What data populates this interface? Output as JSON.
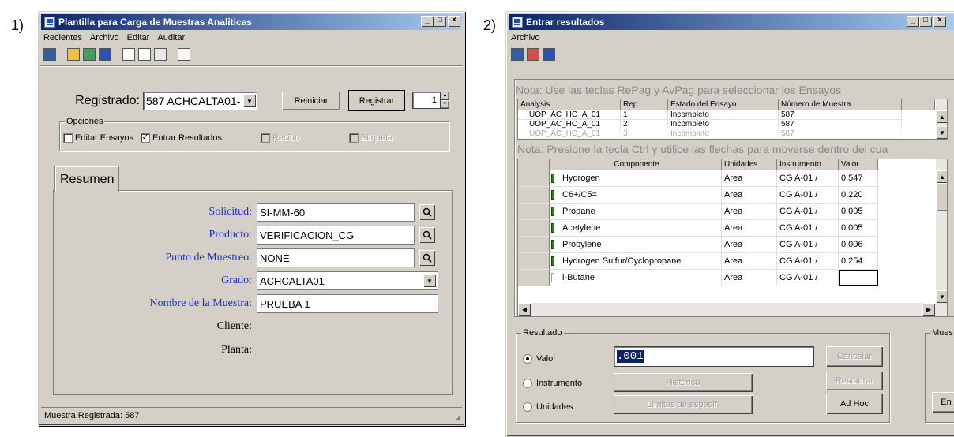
{
  "labels": {
    "one": "1)",
    "two": "2)"
  },
  "window1": {
    "title": "Plantilla para Carga de Muestras Analiticas",
    "menu": [
      "Recientes",
      "Archivo",
      "Editar",
      "Auditar"
    ],
    "registrado_label": "Registrado:",
    "registrado_value": "587   ACHCALTA01-",
    "reiniciar": "Reiniciar",
    "registrar": "Registrar",
    "spin_value": "1",
    "opciones_title": "Opciones",
    "opciones": [
      {
        "label": "Editar Ensayos",
        "checked": false,
        "enabled": true
      },
      {
        "label": "Entrar Resultados",
        "checked": true,
        "enabled": true
      },
      {
        "label": "Recibo",
        "checked": false,
        "enabled": false
      },
      {
        "label": "Etiqueta",
        "checked": false,
        "enabled": false
      }
    ],
    "tab": "Resumen",
    "fields": {
      "solicitud": {
        "label": "Solicitud:",
        "value": "SI-MM-60"
      },
      "producto": {
        "label": "Producto:",
        "value": "VERIFICACION_CG"
      },
      "punto": {
        "label": "Punto de Muestreo:",
        "value": "NONE"
      },
      "grado": {
        "label": "Grado:",
        "value": "ACHCALTA01"
      },
      "nombre": {
        "label": "Nombre de la Muestra:",
        "value": "PRUEBA 1"
      },
      "cliente": {
        "label": "Cliente:"
      },
      "planta": {
        "label": "Planta:"
      }
    },
    "status": "Muestra Registrada: 587"
  },
  "window2": {
    "title": "Entrar resultados",
    "menu": [
      "Archivo"
    ],
    "note1": "Nota:  Use las teclas RePag y AvPag para seleccionar los Ensayos",
    "grid1": {
      "headers": [
        "Analysis",
        "Rep",
        "Estado del Ensayo",
        "Número de Muestra"
      ],
      "rows": [
        [
          "UOP_AC_HC_A_01",
          "1",
          "Incompleto",
          "587"
        ],
        [
          "UOP_AC_HC_A_01",
          "2",
          "Incompleto",
          "587"
        ],
        [
          "UOP_AC_HC_A_01",
          "3",
          "Incompleto",
          "587"
        ]
      ]
    },
    "note2": "Nota: Presione la tecla Ctrl y utilice las flechas para moverse dentro del cua",
    "grid2": {
      "headers": [
        "Componente",
        "Unidades",
        "Instrumento",
        "Valor"
      ],
      "rows": [
        [
          "Hydrogen",
          "Area",
          "CG A-01 /",
          "0.547"
        ],
        [
          "C6+/C5=",
          "Area",
          "CG A-01 /",
          "0.220"
        ],
        [
          "Propane",
          "Area",
          "CG A-01 /",
          "0.005"
        ],
        [
          "Acetylene",
          "Area",
          "CG A-01 /",
          "0.005"
        ],
        [
          "Propylene",
          "Area",
          "CG A-01 /",
          "0.006"
        ],
        [
          "Hydrogen Sulfur/Cyclopropane",
          "Area",
          "CG A-01 /",
          "0.254"
        ],
        [
          "i-Butane",
          "Area",
          "CG A-01 /",
          ""
        ]
      ]
    },
    "resultado_title": "Resultado",
    "radios": [
      {
        "label": "Valor",
        "selected": true
      },
      {
        "label": "Instrumento",
        "selected": false
      },
      {
        "label": "Unidades",
        "selected": false
      }
    ],
    "value_input": ".001",
    "historico": "Histórico",
    "limites": "Límites de especif.",
    "cancelar": "Cancelar",
    "restaurar": "Restaurar",
    "adhoc": "Ad Hoc",
    "muestra_title": "Mues",
    "partial_btn": "En"
  }
}
